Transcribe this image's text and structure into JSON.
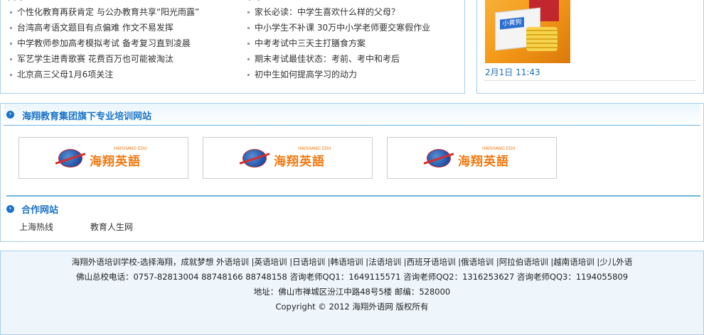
{
  "news": {
    "left": {
      "title": "高考",
      "items": [
        "个性化教育再获肯定 与公办教育共享“阳光雨露”",
        "台湾高考语文题目有点偏难 作文不易发挥",
        "中学教师参加高考模拟考试 备考复习直到凌晨",
        "军艺学生进青歌赛 花费百万也可能被淘汰",
        "北京高三父母1月6项关注"
      ]
    },
    "right": {
      "title": "中考",
      "items": [
        "家长必读：中学生喜欢什么样的父母？",
        "中小学生不补课 30万中小学老师要交寒假作业",
        "中考考试中三天主打膳食方案",
        "期末考试最佳状态：考前、考中和考后",
        "初中生如何提高学习的动力"
      ]
    }
  },
  "side": {
    "thumb_card_text": "小黄狗",
    "date": "2月1日 11:43"
  },
  "training": {
    "title": "海翔教育集团旗下专业培训网站",
    "logo_text": "海翔英語",
    "logo_sub": "HAISHANG EDU"
  },
  "partners": {
    "title": "合作网站",
    "links": [
      "上海热线",
      "教育人生网"
    ]
  },
  "footer": {
    "line1": "海翔外语培训学校-选择海翔，成就梦想  外语培训 |英语培训 |日语培训 |韩语培训 |法语培训 |西班牙语培训 |俄语培训 |阿拉伯语培训 |越南语培训 |少儿外语",
    "line2": "佛山总校电话：0757-82813004  88748166  88748158  咨询老师QQ1：1649115571  咨询老师QQ2：1316253627  咨询老师QQ3：1194055809",
    "line3": "地址：佛山市禅城区汾江中路48号5楼  邮编：528000",
    "line4": "Copyright © 2012  海翔外语网  版权所有"
  }
}
